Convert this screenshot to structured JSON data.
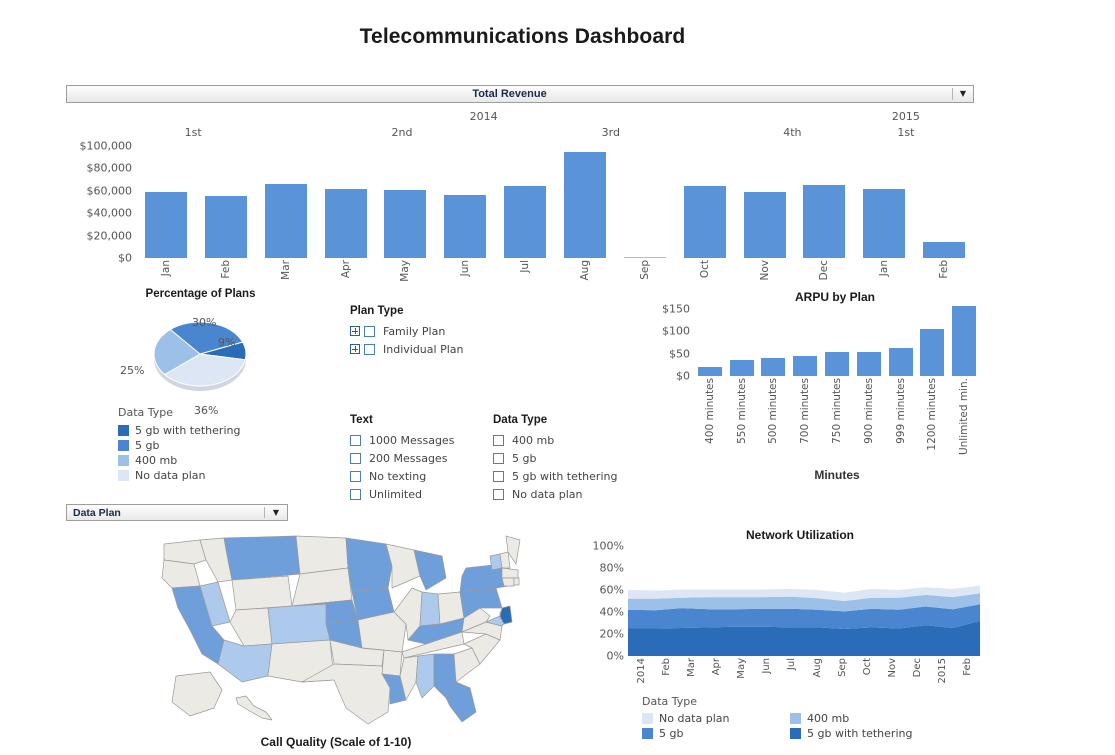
{
  "dashboard": {
    "title": "Telecommunications Dashboard"
  },
  "parameter_bar": {
    "label": "Total Revenue",
    "arrow_icon": "chevron-down-icon"
  },
  "data_plan_dropdown": {
    "label": "Data Plan",
    "arrow_icon": "chevron-down-icon"
  },
  "filters": {
    "plan_type": {
      "title": "Plan Type",
      "items": [
        {
          "label": "Family Plan",
          "checked": false,
          "expandable": true
        },
        {
          "label": "Individual Plan",
          "checked": false,
          "expandable": true
        }
      ]
    },
    "text": {
      "title": "Text",
      "items": [
        {
          "label": "1000 Messages",
          "checked": false
        },
        {
          "label": "200 Messages",
          "checked": false
        },
        {
          "label": "No texting",
          "checked": false
        },
        {
          "label": "Unlimited",
          "checked": false
        }
      ]
    },
    "data_type": {
      "title": "Data Type",
      "items": [
        {
          "label": "400 mb",
          "checked": false
        },
        {
          "label": "5 gb",
          "checked": false
        },
        {
          "label": "5 gb with tethering",
          "checked": false
        },
        {
          "label": "No data plan",
          "checked": false
        }
      ]
    }
  },
  "palette": {
    "bar_blue": "#5b93d8",
    "dark_blue": "#2a6cb8",
    "medium_blue": "#4a86d0",
    "light_blue": "#9dc0e8",
    "pale_blue": "#dce6f5",
    "map_empty": "#eceae4",
    "map_border": "#9a9a9a"
  },
  "chart_data": [
    {
      "id": "total_revenue",
      "type": "bar",
      "title": "Total Revenue",
      "xlabel": "",
      "ylabel": "",
      "ylim": [
        0,
        100000
      ],
      "yticks": [
        "$0",
        "$20,000",
        "$40,000",
        "$60,000",
        "$80,000",
        "$100,000"
      ],
      "ytick_values": [
        0,
        20000,
        40000,
        60000,
        80000,
        100000
      ],
      "grid": false,
      "group_headers": [
        {
          "label": "2014",
          "level": "year",
          "center_pct": 46
        },
        {
          "label": "2015",
          "level": "year",
          "center_pct": 92.5
        },
        {
          "label": "1st",
          "level": "quarter",
          "center_pct": 14
        },
        {
          "label": "2nd",
          "level": "quarter",
          "center_pct": 37
        },
        {
          "label": "3rd",
          "level": "quarter",
          "center_pct": 60
        },
        {
          "label": "4th",
          "level": "quarter",
          "center_pct": 80
        },
        {
          "label": "1st",
          "level": "quarter",
          "center_pct": 92.5
        }
      ],
      "categories": [
        "Jan",
        "Feb",
        "Mar",
        "Apr",
        "May",
        "Jun",
        "Jul",
        "Aug",
        "Sep",
        "Oct",
        "Nov",
        "Dec",
        "Jan",
        "Feb"
      ],
      "values": [
        59000,
        55000,
        66000,
        62000,
        61000,
        56000,
        64000,
        95000,
        500,
        64000,
        59000,
        65000,
        62000,
        14000
      ]
    },
    {
      "id": "percentage_of_plans",
      "type": "pie",
      "title": "Percentage of Plans",
      "legend_title": "Data Type",
      "legend_position": "bottom-left",
      "labels": [
        "5 gb with tethering",
        "5 gb",
        "400 mb",
        "No data plan"
      ],
      "values": [
        9,
        30,
        25,
        36
      ],
      "value_labels": [
        "9%",
        "30%",
        "25%",
        "36%"
      ],
      "colors": [
        "#2a6cb8",
        "#4a86d0",
        "#9dc0e8",
        "#dce6f5"
      ]
    },
    {
      "id": "arpu_by_plan",
      "type": "bar",
      "title": "ARPU by Plan",
      "xlabel": "Minutes",
      "ylabel": "",
      "ylim": [
        0,
        160
      ],
      "yticks": [
        "$0",
        "$50",
        "$100",
        "$150"
      ],
      "ytick_values": [
        0,
        50,
        100,
        150
      ],
      "grid": false,
      "categories": [
        "400 minutes",
        "550 minutes",
        "500 minutes",
        "700 minutes",
        "750 minutes",
        "900 minutes",
        "999 minutes",
        "1200 minutes",
        "Unlimited min."
      ],
      "values": [
        20,
        35,
        40,
        45,
        53,
        53,
        62,
        105,
        155
      ]
    },
    {
      "id": "call_quality_map",
      "type": "map",
      "title": "Call Quality (Scale of 1-10)",
      "region": "United States",
      "states_highlighted": [
        {
          "state": "Montana",
          "shade": "medium"
        },
        {
          "state": "California",
          "shade": "medium"
        },
        {
          "state": "Nevada",
          "shade": "light"
        },
        {
          "state": "Arizona",
          "shade": "light"
        },
        {
          "state": "Colorado",
          "shade": "light"
        },
        {
          "state": "Kansas",
          "shade": "medium"
        },
        {
          "state": "Nebraska",
          "shade": "medium"
        },
        {
          "state": "Minnesota",
          "shade": "medium"
        },
        {
          "state": "Iowa",
          "shade": "medium"
        },
        {
          "state": "Michigan",
          "shade": "medium"
        },
        {
          "state": "Indiana",
          "shade": "light"
        },
        {
          "state": "Kentucky",
          "shade": "medium"
        },
        {
          "state": "Alabama",
          "shade": "light"
        },
        {
          "state": "Georgia",
          "shade": "medium"
        },
        {
          "state": "Florida",
          "shade": "medium"
        },
        {
          "state": "Louisiana",
          "shade": "medium"
        },
        {
          "state": "Pennsylvania",
          "shade": "medium"
        },
        {
          "state": "New York",
          "shade": "medium"
        },
        {
          "state": "New Jersey",
          "shade": "dark"
        },
        {
          "state": "Vermont",
          "shade": "light"
        },
        {
          "state": "Maryland",
          "shade": "light"
        }
      ]
    },
    {
      "id": "network_utilization",
      "type": "area",
      "title": "Network Utilization",
      "xlabel": "",
      "ylabel": "",
      "ylim": [
        0,
        100
      ],
      "yticks": [
        "0%",
        "20%",
        "40%",
        "60%",
        "80%",
        "100%"
      ],
      "ytick_values": [
        0,
        20,
        40,
        60,
        80,
        100
      ],
      "grid": false,
      "stacked": true,
      "legend_title": "Data Type",
      "legend_position": "bottom",
      "x": [
        "2014",
        "Feb",
        "Mar",
        "Apr",
        "May",
        "Jun",
        "Jul",
        "Aug",
        "Sep",
        "Oct",
        "Nov",
        "Dec",
        "2015",
        "Feb"
      ],
      "series": [
        {
          "name": "5 gb with tethering",
          "color": "#2a6cb8",
          "values": [
            25,
            25,
            25.5,
            26,
            26.5,
            26.5,
            26,
            26,
            24.5,
            26,
            25,
            28,
            25.5,
            32
          ]
        },
        {
          "name": "5 gb",
          "color": "#4a86d0",
          "values": [
            17,
            16.5,
            18,
            16.5,
            16,
            16.5,
            17,
            16,
            16,
            17,
            17,
            17,
            17,
            15
          ]
        },
        {
          "name": "400 mb",
          "color": "#9dc0e8",
          "values": [
            10,
            10.5,
            9.5,
            11,
            11,
            10.5,
            11,
            10.5,
            9.5,
            10,
            11,
            10.5,
            11,
            10
          ]
        },
        {
          "name": "No data plan",
          "color": "#dce6f5",
          "values": [
            8,
            7.5,
            7.5,
            7,
            7,
            7,
            7,
            7.5,
            7.5,
            8,
            7,
            7,
            7.5,
            7
          ]
        }
      ],
      "legend_items": [
        {
          "label": "No data plan",
          "color": "#dce6f5"
        },
        {
          "label": "400 mb",
          "color": "#9dc0e8"
        },
        {
          "label": "5 gb",
          "color": "#4a86d0"
        },
        {
          "label": "5 gb with tethering",
          "color": "#2a6cb8"
        }
      ]
    }
  ]
}
